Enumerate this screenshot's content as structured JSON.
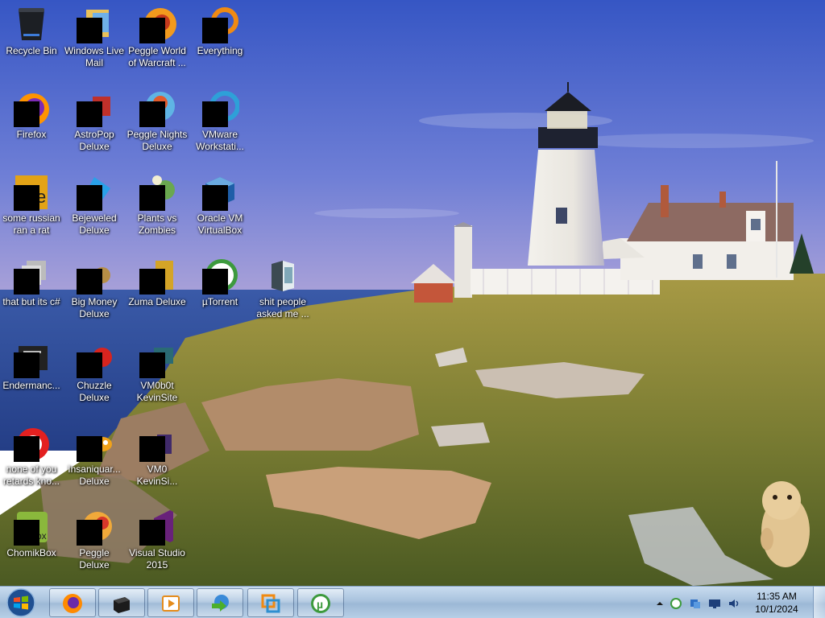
{
  "desktop": {
    "icons": [
      {
        "label": "Recycle Bin"
      },
      {
        "label": "Windows Live Mail"
      },
      {
        "label": "Peggle World of Warcraft ..."
      },
      {
        "label": "Everything"
      },
      {
        "label": "Firefox"
      },
      {
        "label": "AstroPop Deluxe"
      },
      {
        "label": "Peggle Nights Deluxe"
      },
      {
        "label": "VMware Workstati..."
      },
      {
        "label": "some russian ran a rat"
      },
      {
        "label": "Bejeweled Deluxe"
      },
      {
        "label": "Plants vs Zombies"
      },
      {
        "label": "Oracle VM VirtualBox"
      },
      {
        "label": "that but its c#"
      },
      {
        "label": "Big Money Deluxe"
      },
      {
        "label": "Zuma Deluxe"
      },
      {
        "label": "µTorrent"
      },
      {
        "label": "shit people asked me ..."
      },
      {
        "label": "Endermanc..."
      },
      {
        "label": "Chuzzle Deluxe"
      },
      {
        "label": "VM0b0t KevinSite"
      },
      {
        "label": "none of you retards kno..."
      },
      {
        "label": "Insaniquar... Deluxe"
      },
      {
        "label": "VM0 KevinSi..."
      },
      {
        "label": "ChomikBox"
      },
      {
        "label": "Peggle Deluxe"
      },
      {
        "label": "Visual Studio 2015"
      }
    ]
  },
  "taskbar": {
    "pinned": [
      {
        "icon": "firefox-icon"
      },
      {
        "icon": "terminal-icon"
      },
      {
        "icon": "media-player-icon"
      },
      {
        "icon": "download-manager-icon"
      },
      {
        "icon": "vmware-icon"
      },
      {
        "icon": "utorrent-icon"
      }
    ],
    "clock": {
      "time": "11:35 AM",
      "date": "10/1/2024"
    }
  },
  "colors": {
    "sky_top": "#3b5fc7",
    "sky_horizon": "#a9a3d8",
    "sea": "#2b4a9b",
    "grass": "#8c8a3a",
    "taskbar": "#b4cbe3"
  }
}
